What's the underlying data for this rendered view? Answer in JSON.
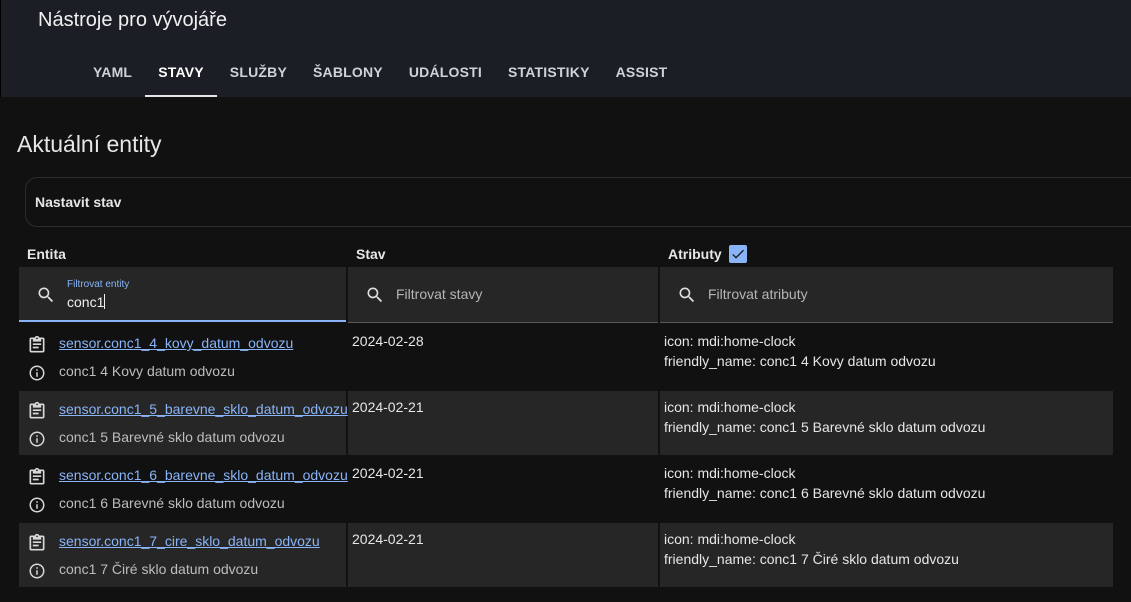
{
  "app": {
    "title": "Nástroje pro vývojáře"
  },
  "tabs": [
    {
      "label": "YAML",
      "active": false
    },
    {
      "label": "STAVY",
      "active": true
    },
    {
      "label": "SLUŽBY",
      "active": false
    },
    {
      "label": "ŠABLONY",
      "active": false
    },
    {
      "label": "UDÁLOSTI",
      "active": false
    },
    {
      "label": "STATISTIKY",
      "active": false
    },
    {
      "label": "ASSIST",
      "active": false
    }
  ],
  "page": {
    "title": "Aktuální entity"
  },
  "set_state": {
    "label": "Nastavit stav"
  },
  "columns": {
    "entity": "Entita",
    "state": "Stav",
    "attributes": "Atributy",
    "attributes_checked": true
  },
  "filters": {
    "entity": {
      "label": "Filtrovat entity",
      "value": "conc1"
    },
    "state": {
      "placeholder": "Filtrovat stavy"
    },
    "attributes": {
      "placeholder": "Filtrovat atributy"
    }
  },
  "rows": [
    {
      "entity_id": "sensor.conc1_4_kovy_datum_odvozu",
      "friendly": "conc1 4 Kovy datum odvozu",
      "state": "2024-02-28",
      "attr_icon": "icon: mdi:home-clock",
      "attr_name": "friendly_name: conc1 4 Kovy datum odvozu"
    },
    {
      "entity_id": "sensor.conc1_5_barevne_sklo_datum_odvozu",
      "friendly": "conc1 5 Barevné sklo datum odvozu",
      "state": "2024-02-21",
      "attr_icon": "icon: mdi:home-clock",
      "attr_name": "friendly_name: conc1 5 Barevné sklo datum odvozu"
    },
    {
      "entity_id": "sensor.conc1_6_barevne_sklo_datum_odvozu",
      "friendly": "conc1 6 Barevné sklo datum odvozu",
      "state": "2024-02-21",
      "attr_icon": "icon: mdi:home-clock",
      "attr_name": "friendly_name: conc1 6 Barevné sklo datum odvozu"
    },
    {
      "entity_id": "sensor.conc1_7_cire_sklo_datum_odvozu",
      "friendly": "conc1 7 Čiré sklo datum odvozu",
      "state": "2024-02-21",
      "attr_icon": "icon: mdi:home-clock",
      "attr_name": "friendly_name: conc1 7 Čiré sklo datum odvozu"
    }
  ],
  "icons": {
    "search": "magnify-icon",
    "copy": "clipboard-list-icon",
    "info": "information-outline-icon",
    "check": "check-icon"
  },
  "colors": {
    "accent": "#8ab4f8",
    "header_bg": "#1b1f25",
    "page_bg": "#111111",
    "row_alt": "#262626"
  }
}
